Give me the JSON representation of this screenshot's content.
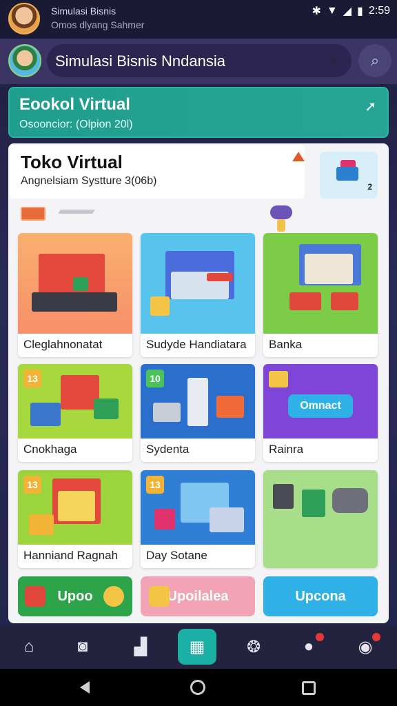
{
  "status_bar": {
    "line1": "Simulasi Bisnis",
    "line2": "Omos dlyang Sahmer",
    "time": "2:59",
    "icons": [
      "bluetooth-icon",
      "wifi-icon",
      "signal-icon",
      "battery-icon"
    ]
  },
  "header": {
    "title": "Simulasi Bisnis Nndansia",
    "action_icon": "edit-icon",
    "search_icon": "search-icon"
  },
  "banner": {
    "title": "Eookol Virtual",
    "subtitle": "Osooncior:   (Olpion 20l)"
  },
  "toko": {
    "title": "Toko Virtual",
    "subtitle": "Angnelsiam Systture 3(06b)",
    "thumb_badge": "2"
  },
  "cards": [
    {
      "label": "Cleglahnonatat",
      "bg": "#f7a06a"
    },
    {
      "label": "Sudyde Handiatara",
      "bg": "#58c3ec"
    },
    {
      "label": "Banka",
      "bg": "#7ccc48"
    },
    {
      "label": "Cnokhaga",
      "bg": "#a7d93e",
      "num": "13"
    },
    {
      "label": "Sydenta",
      "bg": "#2b6fcc",
      "num": "10"
    },
    {
      "label": "Rainra",
      "bg": "#7f45d6",
      "button": "Omnact"
    },
    {
      "label": "Hanniand Ragnah",
      "bg": "#9bd43c",
      "num": "13"
    },
    {
      "label": "Day Sotane",
      "bg": "#2f7fd6",
      "num": "13"
    },
    {
      "label": "",
      "bg": "#a8de8a"
    }
  ],
  "bottom_buttons": [
    {
      "label": "Upoo",
      "bg": "#2da34a"
    },
    {
      "label": "Upoilalea",
      "bg": "#f2a4b6"
    },
    {
      "label": "Upcona",
      "bg": "#2fb0e6"
    }
  ],
  "nav": {
    "items": [
      "home-icon",
      "camera-icon",
      "chat-icon",
      "store-icon",
      "reel-icon",
      "profile-icon",
      "notification-icon"
    ]
  }
}
